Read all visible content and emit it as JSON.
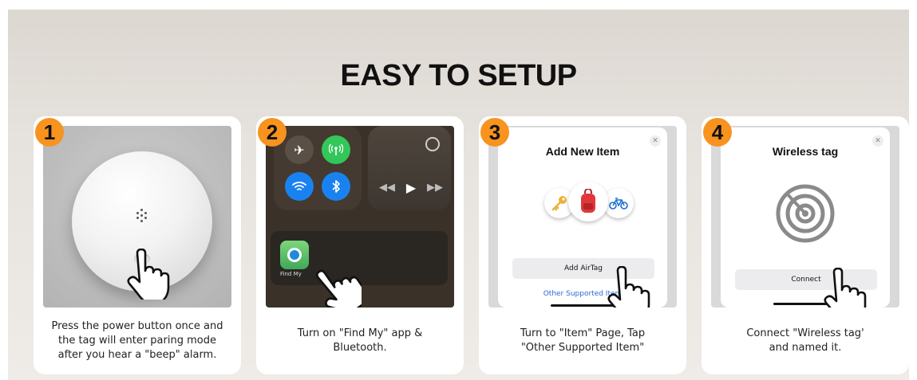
{
  "title": "EASY TO SETUP",
  "steps": [
    {
      "number": "1",
      "caption": "Press the power button once and\nthe tag will enter paring mode\nafter you hear a \"beep\" alarm."
    },
    {
      "number": "2",
      "caption": "Turn on \"Find My\" app &\nBluetooth.",
      "app_label": "Find My"
    },
    {
      "number": "3",
      "caption": "Turn to \"Item\" Page, Tap\n\"Other Supported Item\"",
      "sheet_title": "Add New Item",
      "button_label": "Add AirTag",
      "link_label": "Other Supported Item"
    },
    {
      "number": "4",
      "caption": "Connect \"Wireless tag'\nand named it.",
      "sheet_title": "Wireless tag",
      "button_label": "Connect"
    }
  ],
  "icons": [
    "tracker-device",
    "pointing-hand-icon",
    "airplane-icon",
    "cellular-icon",
    "wifi-icon",
    "bluetooth-icon",
    "airplay-icon",
    "find-my-app-icon",
    "key-icon",
    "backpack-icon",
    "bicycle-icon",
    "close-icon",
    "radar-icon"
  ],
  "colors": {
    "badge": "#f7931e",
    "link": "#2a6bd8",
    "cc_blue": "#1a82f0",
    "cc_green": "#33c759"
  }
}
